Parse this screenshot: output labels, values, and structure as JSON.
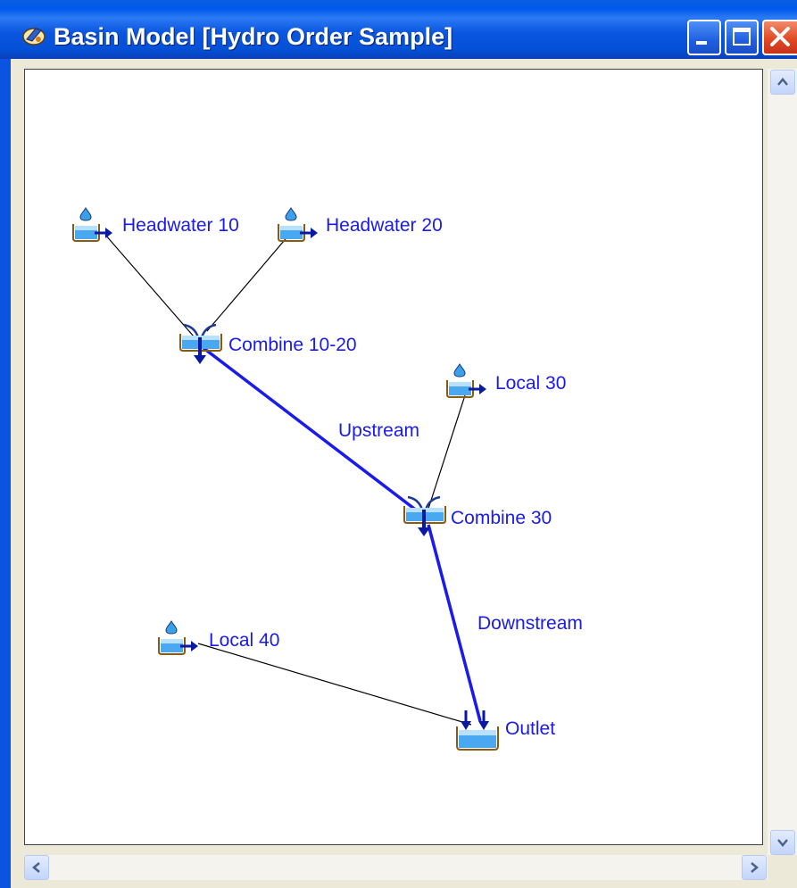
{
  "window": {
    "title": "Basin Model [Hydro Order Sample]",
    "icon": "hms-basin-icon",
    "buttons": [
      "minimize",
      "maximize",
      "close"
    ]
  },
  "colors": {
    "title_bar": "#0058ee",
    "label_text": "#1a1aee",
    "reach_line": "#1a1aee",
    "connector_line": "#000000",
    "canvas_bg": "#ffffff"
  },
  "nodes": {
    "headwater10": {
      "label": "Headwater 10",
      "type": "subbasin",
      "icon": "subbasin-icon"
    },
    "headwater20": {
      "label": "Headwater 20",
      "type": "subbasin",
      "icon": "subbasin-icon"
    },
    "combine1020": {
      "label": "Combine 10-20",
      "type": "junction",
      "icon": "junction-icon"
    },
    "local30": {
      "label": "Local 30",
      "type": "subbasin",
      "icon": "subbasin-icon"
    },
    "combine30": {
      "label": "Combine 30",
      "type": "junction",
      "icon": "junction-icon"
    },
    "local40": {
      "label": "Local 40",
      "type": "subbasin",
      "icon": "subbasin-icon"
    },
    "outlet": {
      "label": "Outlet",
      "type": "sink",
      "icon": "sink-icon"
    }
  },
  "reaches": {
    "upstream": {
      "label": "Upstream",
      "from": "Combine 10-20",
      "to": "Combine 30"
    },
    "downstream": {
      "label": "Downstream",
      "from": "Combine 30",
      "to": "Outlet"
    }
  },
  "scrollbars": {
    "vertical": [
      "scroll-up",
      "scroll-down"
    ],
    "horizontal": [
      "scroll-left",
      "scroll-right"
    ]
  }
}
